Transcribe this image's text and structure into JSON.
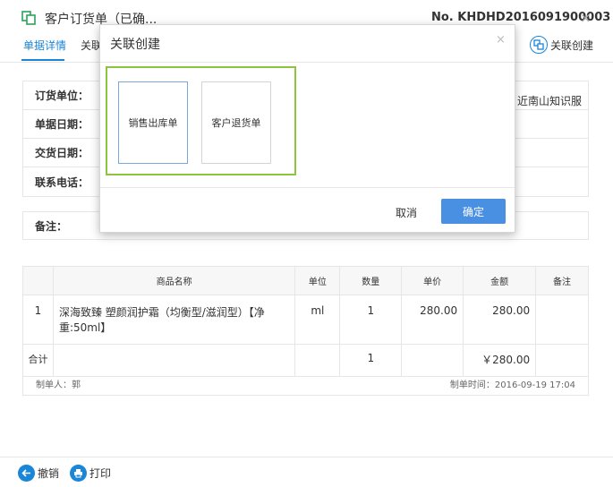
{
  "header": {
    "title": "客户订货单（已确...",
    "doc_no": "No. KHDHD2016091900003",
    "close_icon": "close-icon",
    "tabs": [
      {
        "label": "单据详情",
        "active": true
      },
      {
        "label": "关联",
        "active": false
      }
    ],
    "link_create": "关联创建"
  },
  "info": {
    "order_unit_label": "订货单位：",
    "doc_date_label": "单据日期：",
    "delivery_date_label": "交货日期：",
    "phone_label": "联系电话：",
    "right_partial_text": "近南山知识服",
    "remark_label": "备注："
  },
  "table": {
    "headers": [
      "",
      "商品名称",
      "单位",
      "数量",
      "单价",
      "金额",
      "备注"
    ],
    "rows": [
      {
        "idx": "1",
        "name": "深海致臻 塑颜润护霜（均衡型/滋润型）【净重:50ml】",
        "unit": "ml",
        "qty": "1",
        "price": "280.00",
        "amount": "280.00",
        "note": ""
      }
    ],
    "total": {
      "label": "合计",
      "qty": "1",
      "amount": "￥280.00"
    }
  },
  "footer": {
    "maker": "制单人：郭",
    "time": "制单时间：2016-09-19 17:04"
  },
  "bottom_bar": {
    "undo_label": "撤销",
    "print_label": "打印"
  },
  "modal": {
    "title": "关联创建",
    "options": [
      "销售出库单",
      "客户退货单"
    ],
    "selected": "销售出库单",
    "cancel_label": "取消",
    "ok_label": "确定"
  },
  "colors": {
    "accent": "#1a86d8",
    "ok_button": "#4a90e2",
    "highlight_frame": "#8cc63f",
    "border": "#e6e6e6"
  }
}
